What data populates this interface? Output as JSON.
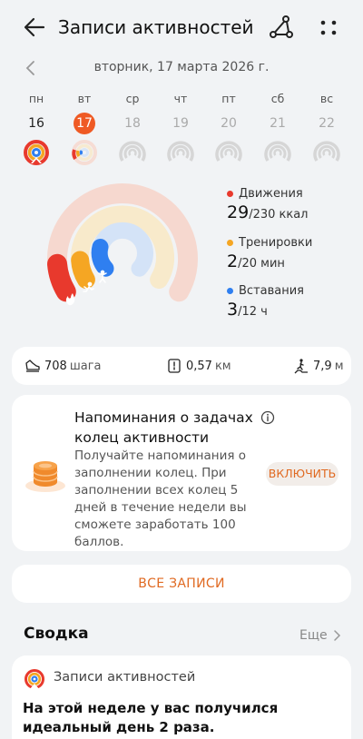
{
  "header": {
    "title": "Записи активностей"
  },
  "date": {
    "label": "вторник, 17 марта 2026 г."
  },
  "week": [
    {
      "dow": "пн",
      "num": "16",
      "state": "past"
    },
    {
      "dow": "вт",
      "num": "17",
      "state": "today"
    },
    {
      "dow": "ср",
      "num": "18",
      "state": "future"
    },
    {
      "dow": "чт",
      "num": "19",
      "state": "future"
    },
    {
      "dow": "пт",
      "num": "20",
      "state": "future"
    },
    {
      "dow": "сб",
      "num": "21",
      "state": "future"
    },
    {
      "dow": "вс",
      "num": "22",
      "state": "future"
    }
  ],
  "rings": {
    "move": {
      "label": "Движения",
      "value": "29",
      "goal": "/230 ккал",
      "color": "#e8392d",
      "progress": 0.126
    },
    "exercise": {
      "label": "Тренировки",
      "value": "2",
      "goal": "/20 мин",
      "color": "#f5a623",
      "progress": 0.1
    },
    "stand": {
      "label": "Вставания",
      "value": "3",
      "goal": "/12 ч",
      "color": "#2f7ff0",
      "progress": 0.25
    }
  },
  "metrics": {
    "steps": {
      "value": "708",
      "unit": "шага"
    },
    "distance": {
      "value": "0,57",
      "unit": "км"
    },
    "climb": {
      "value": "7,9",
      "unit": "м"
    }
  },
  "reminder": {
    "title": "Напоминания о задачах колец активности",
    "body": "Получайте напоминания о заполнении колец. При заполнении всех колец 5 дней в течение недели вы сможете заработать 100 баллов.",
    "button": "ВКЛЮЧИТЬ"
  },
  "all_records": "ВСЕ ЗАПИСИ",
  "summary": {
    "header": "Сводка",
    "more": "Еще",
    "card_title": "Записи активностей",
    "card_text": "На этой неделе у вас получился идеальный день 2 раза."
  }
}
